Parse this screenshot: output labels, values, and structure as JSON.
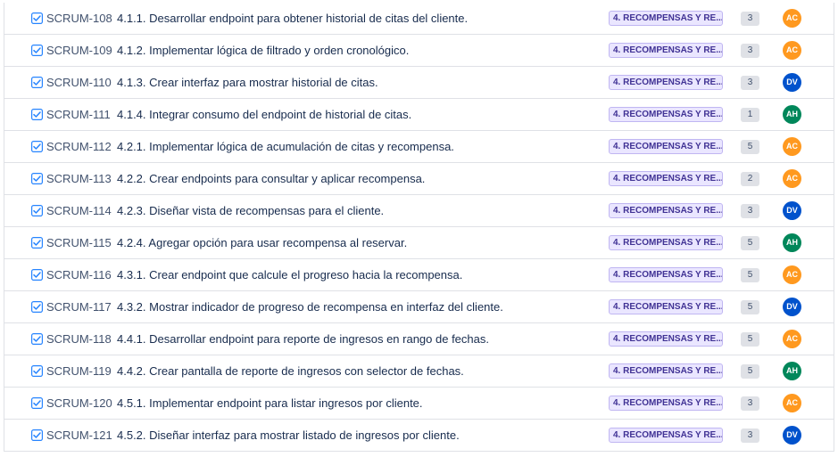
{
  "assignee_colors": {
    "AC": "#ff991f",
    "DV": "#0052cc",
    "AH": "#00875a"
  },
  "icon": "checkbox-task-icon",
  "rows": [
    {
      "key": "SCRUM-108",
      "summary": "4.1.1. Desarrollar endpoint para obtener historial de citas del cliente.",
      "epic": "4. RECOMPENSAS Y RE...",
      "points": "3",
      "assignee": "AC"
    },
    {
      "key": "SCRUM-109",
      "summary": "4.1.2. Implementar lógica de filtrado y orden cronológico.",
      "epic": "4. RECOMPENSAS Y RE...",
      "points": "3",
      "assignee": "AC"
    },
    {
      "key": "SCRUM-110",
      "summary": "4.1.3. Crear interfaz para mostrar historial de citas.",
      "epic": "4. RECOMPENSAS Y RE...",
      "points": "3",
      "assignee": "DV"
    },
    {
      "key": "SCRUM-111",
      "summary": "4.1.4. Integrar consumo del endpoint de historial de citas.",
      "epic": "4. RECOMPENSAS Y RE...",
      "points": "1",
      "assignee": "AH"
    },
    {
      "key": "SCRUM-112",
      "summary": "4.2.1. Implementar lógica de acumulación de citas y recompensa.",
      "epic": "4. RECOMPENSAS Y RE...",
      "points": "5",
      "assignee": "AC"
    },
    {
      "key": "SCRUM-113",
      "summary": "4.2.2. Crear endpoints para consultar y aplicar recompensa.",
      "epic": "4. RECOMPENSAS Y RE...",
      "points": "2",
      "assignee": "AC"
    },
    {
      "key": "SCRUM-114",
      "summary": "4.2.3. Diseñar vista de recompensas para el cliente.",
      "epic": "4. RECOMPENSAS Y RE...",
      "points": "3",
      "assignee": "DV"
    },
    {
      "key": "SCRUM-115",
      "summary": "4.2.4. Agregar opción para usar recompensa al reservar.",
      "epic": "4. RECOMPENSAS Y RE...",
      "points": "5",
      "assignee": "AH"
    },
    {
      "key": "SCRUM-116",
      "summary": "4.3.1. Crear endpoint que calcule el progreso hacia la recompensa.",
      "epic": "4. RECOMPENSAS Y RE...",
      "points": "5",
      "assignee": "AC"
    },
    {
      "key": "SCRUM-117",
      "summary": "4.3.2. Mostrar indicador de progreso de recompensa en interfaz del cliente.",
      "epic": "4. RECOMPENSAS Y RE...",
      "points": "5",
      "assignee": "DV"
    },
    {
      "key": "SCRUM-118",
      "summary": "4.4.1. Desarrollar endpoint para reporte de ingresos en rango de fechas.",
      "epic": "4. RECOMPENSAS Y RE...",
      "points": "5",
      "assignee": "AC"
    },
    {
      "key": "SCRUM-119",
      "summary": "4.4.2. Crear pantalla de reporte de ingresos con selector de fechas.",
      "epic": "4. RECOMPENSAS Y RE...",
      "points": "5",
      "assignee": "AH"
    },
    {
      "key": "SCRUM-120",
      "summary": "4.5.1. Implementar endpoint para listar ingresos por cliente.",
      "epic": "4. RECOMPENSAS Y RE...",
      "points": "3",
      "assignee": "AC"
    },
    {
      "key": "SCRUM-121",
      "summary": "4.5.2. Diseñar interfaz para mostrar listado de ingresos por cliente.",
      "epic": "4. RECOMPENSAS Y RE...",
      "points": "3",
      "assignee": "DV"
    }
  ]
}
